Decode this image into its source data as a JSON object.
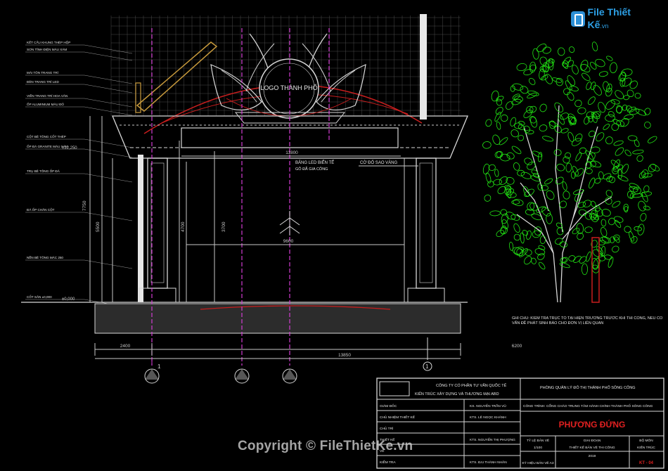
{
  "watermark": {
    "logo_text": "File Thiết Kế",
    "logo_suffix": ".vn",
    "copyright": "Copyright © FileThietKe.vn"
  },
  "drawing": {
    "logo_label": "LOGO THÀNH PHỐ",
    "sign_label": "BẢNG LED BIỂN TỂ",
    "sign_sub": "GỖ ĐÃ GIA CÔNG",
    "flag_label": "CỜ ĐỎ SAO VÀNG",
    "level_top": "±12,250",
    "level_ground": "±0,000",
    "dim_total": "13850",
    "dim_left": "2400",
    "dim_right": "6200",
    "dim_mid": "9600",
    "dim_span": "11800",
    "dim_h1": "7750",
    "dim_h2": "5500",
    "dim_h3": "4700",
    "dim_h4": "3700",
    "note_right": "GHI CHÚ: KIỂM TRA TRỤC TỔ TẠI HIỆN TRƯỜNG TRƯỚC KHI THI CÔNG, NẾU CÓ VẤN ĐỀ PHÁT SINH BÁO CHO ĐƠN VỊ LIÊN QUAN",
    "axis_markers": [
      "1",
      "1",
      "2",
      "3"
    ],
    "left_notes": [
      "KẾT CẤU KHUNG THÉP HỘP",
      "SƠN TĨNH ĐIỆN MÀU XÁM",
      "MÁI TÔN TRANG TRÍ",
      "ĐÈN TRANG TRÍ LED",
      "VIỀN TRANG TRÍ HOA VĂN",
      "ỐP ALUMINIUM MÀU ĐỎ",
      "CỘT BÊ TÔNG CỐT THÉP",
      "ỐP ĐÁ GRANITE MÀU XÁM",
      "TRỤ BÊ TÔNG ỐP ĐÁ",
      "ĐÁ ỐP CHÂN CỘT",
      "NỀN BÊ TÔNG MÁC 250",
      "CỐT SÂN ±0,000"
    ]
  },
  "title_block": {
    "company": "CÔNG TY CỔ PHẦN TƯ VẤN QUỐC TẾ",
    "company_sub": "KIẾN TRÚC XÂY DỰNG VÀ THƯƠNG MẠI ABD",
    "client": "PHÒNG QUẢN LÝ ĐÔ THỊ THÀNH PHỐ SÔNG CÔNG",
    "project": "CÔNG TRÌNH: CỔNG CHÀO TRUNG TÂM HÀNH CHÍNH THÀNH PHỐ SÔNG CÔNG",
    "drawing_title": "PHƯƠNG ĐỨNG",
    "rows": [
      {
        "role": "GIÁM ĐỐC",
        "name": "KS. NGUYỄN TRẦN VŨ"
      },
      {
        "role": "CHỦ NHIỆM THIẾT KẾ",
        "name": "KTS. LÊ NGỌC KHÁNH"
      },
      {
        "role": "CHỦ TRÌ",
        "name": ""
      },
      {
        "role": "THIẾT KẾ",
        "name": "KTS. NGUYỄN THỊ PHƯỢNG"
      },
      {
        "role": "VẼ",
        "name": ""
      },
      {
        "role": "KIỂM TRA",
        "name": "KTS. ĐẠI THÀNH NHÂN"
      }
    ],
    "scale_label": "TỶ LỆ BẢN VẼ",
    "scale": "1/100",
    "phase_label": "GIAI ĐOẠN",
    "phase": "THIẾT KẾ BẢN VẼ THI CÔNG",
    "year": "2019",
    "sheet_label": "KÝ HIỆU BẢN VẼ A3",
    "discipline_label": "BỘ MÔN",
    "discipline": "KIẾN TRÚC",
    "sheet_no": "KT - 04"
  },
  "colors": {
    "background": "#000000",
    "dim_line": "#c8c8c8",
    "structure": "#d8d8d8",
    "axis_magenta": "#d23cd2",
    "arch_red": "#c81e1e",
    "tree": "#22e614",
    "trunk": "#d8d8d8",
    "gold": "#c89a3c",
    "title_red": "#e02020"
  }
}
